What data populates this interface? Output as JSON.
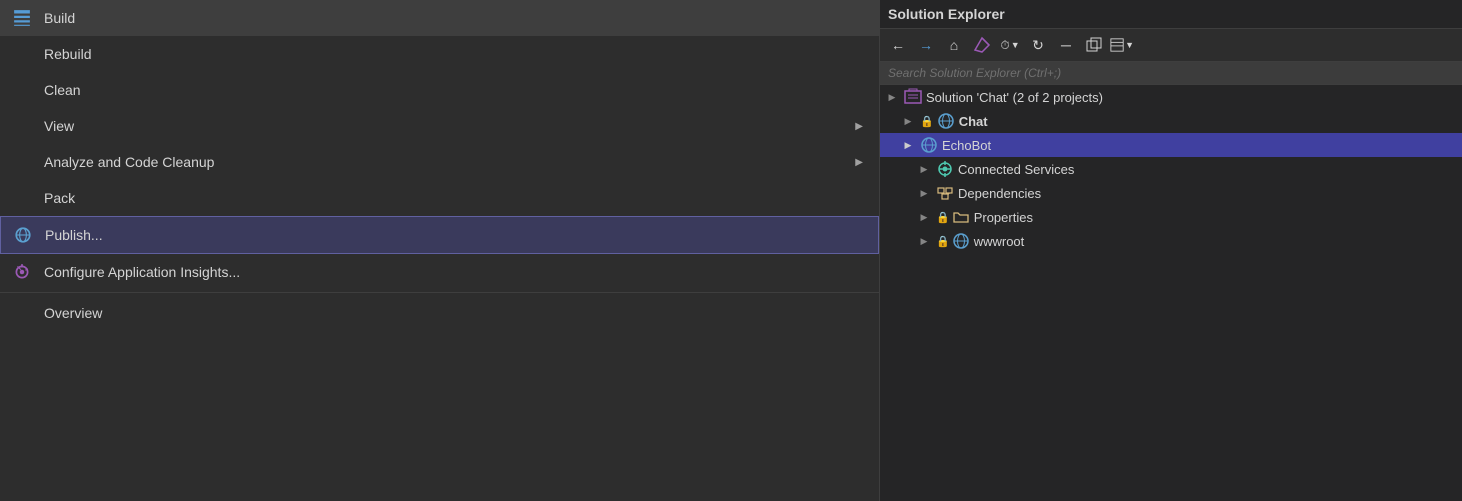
{
  "menu": {
    "items": [
      {
        "id": "build",
        "label": "Build",
        "icon": "build-icon",
        "hasSubmenu": false,
        "hasBorder": false,
        "highlighted": false,
        "hasIcon": true
      },
      {
        "id": "rebuild",
        "label": "Rebuild",
        "icon": null,
        "hasSubmenu": false,
        "hasBorder": false,
        "highlighted": false,
        "hasIcon": false
      },
      {
        "id": "clean",
        "label": "Clean",
        "icon": null,
        "hasSubmenu": false,
        "hasBorder": false,
        "highlighted": false,
        "hasIcon": false
      },
      {
        "id": "view",
        "label": "View",
        "icon": null,
        "hasSubmenu": true,
        "hasBorder": false,
        "highlighted": false,
        "hasIcon": false
      },
      {
        "id": "analyze",
        "label": "Analyze and Code Cleanup",
        "icon": null,
        "hasSubmenu": true,
        "hasBorder": false,
        "highlighted": false,
        "hasIcon": false
      },
      {
        "id": "pack",
        "label": "Pack",
        "icon": null,
        "hasSubmenu": false,
        "hasBorder": false,
        "highlighted": false,
        "hasIcon": false
      },
      {
        "id": "publish",
        "label": "Publish...",
        "icon": "publish-icon",
        "hasSubmenu": false,
        "hasBorder": false,
        "highlighted": true,
        "hasIcon": true
      },
      {
        "id": "configure-insights",
        "label": "Configure Application Insights...",
        "icon": "insights-icon",
        "hasSubmenu": false,
        "hasBorder": true,
        "highlighted": false,
        "hasIcon": true
      },
      {
        "id": "overview",
        "label": "Overview",
        "icon": null,
        "hasSubmenu": false,
        "hasBorder": false,
        "highlighted": false,
        "hasIcon": false
      }
    ]
  },
  "solution_explorer": {
    "title": "Solution Explorer",
    "search_placeholder": "Search Solution Explorer (Ctrl+;)",
    "tree": {
      "solution_label": "Solution 'Chat' (2 of 2 projects)",
      "chat_label": "Chat",
      "echobot_label": "EchoBot",
      "connected_services_label": "Connected Services",
      "dependencies_label": "Dependencies",
      "properties_label": "Properties",
      "wwwroot_label": "wwwroot"
    },
    "toolbar_buttons": [
      "←",
      "→",
      "🏠",
      "≡",
      "⏱",
      "▼",
      "↻",
      "▬",
      "▭",
      "⊞",
      "▼"
    ]
  }
}
